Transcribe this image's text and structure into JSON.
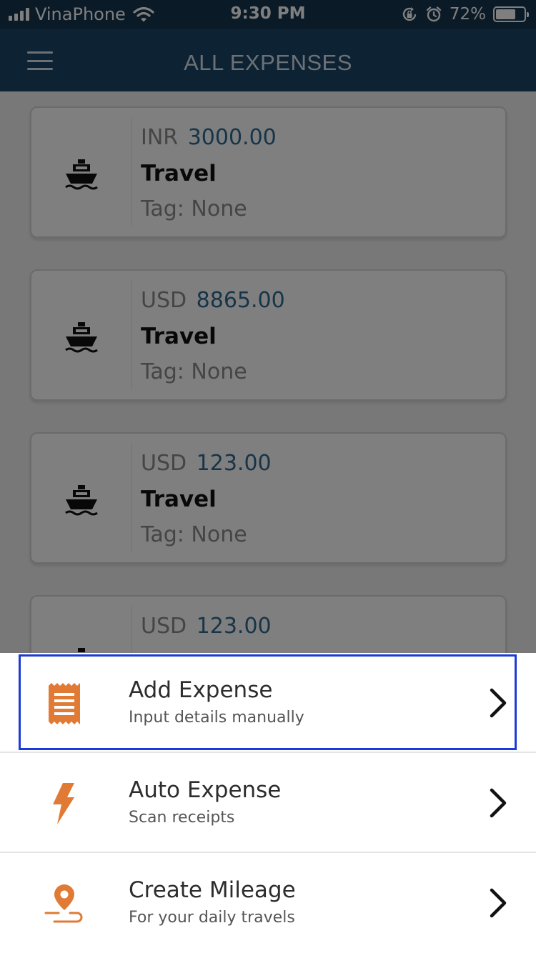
{
  "status_bar": {
    "carrier": "VinaPhone",
    "time": "9:30 PM",
    "battery_percent": "72%",
    "battery_level": 0.72,
    "icons": [
      "signal-icon",
      "wifi-icon",
      "rotation-lock-icon",
      "alarm-icon",
      "battery-icon"
    ]
  },
  "header": {
    "title": "ALL EXPENSES",
    "menu_icon": "hamburger-menu-icon"
  },
  "expenses": [
    {
      "currency": "INR",
      "amount": "3000.00",
      "category": "Travel",
      "tag": "Tag: None",
      "icon": "ship-icon"
    },
    {
      "currency": "USD",
      "amount": "8865.00",
      "category": "Travel",
      "tag": "Tag: None",
      "icon": "ship-icon"
    },
    {
      "currency": "USD",
      "amount": "123.00",
      "category": "Travel",
      "tag": "Tag: None",
      "icon": "ship-icon"
    },
    {
      "currency": "USD",
      "amount": "123.00",
      "category": "",
      "tag": "",
      "icon": "ship-icon"
    }
  ],
  "actions": [
    {
      "title": "Add Expense",
      "subtitle": "Input details manually",
      "icon": "receipt-icon",
      "highlighted": true
    },
    {
      "title": "Auto Expense",
      "subtitle": "Scan receipts",
      "icon": "lightning-icon",
      "highlighted": false
    },
    {
      "title": "Create Mileage",
      "subtitle": "For your daily travels",
      "icon": "location-pin-icon",
      "highlighted": false
    }
  ],
  "colors": {
    "status_bar_bg": "#14344f",
    "header_bg": "#1a4566",
    "amount_value": "#2f6a91",
    "accent_orange": "#e07a34",
    "highlight_border": "#1b3ad8"
  }
}
